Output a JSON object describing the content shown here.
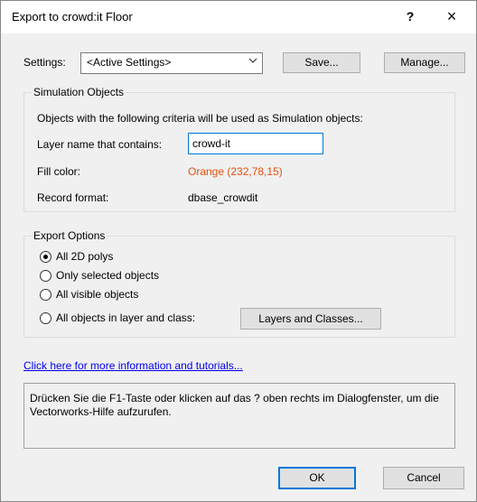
{
  "dialog": {
    "title": "Export to crowd:it Floor",
    "help_label": "?",
    "close_label": "×"
  },
  "settings": {
    "label": "Settings:",
    "selected": "<Active Settings>",
    "save_label": "Save...",
    "manage_label": "Manage..."
  },
  "simulation": {
    "group_title": "Simulation Objects",
    "description": "Objects with the following criteria will be used as Simulation objects:",
    "layer_label": "Layer name that contains:",
    "layer_value": "crowd-it",
    "fill_label": "Fill color:",
    "fill_value": "Orange (232,78,15)",
    "fill_color": "#e84e0f",
    "record_label": "Record format:",
    "record_value": "dbase_crowdit"
  },
  "export_options": {
    "group_title": "Export Options",
    "options": [
      {
        "label": "All 2D polys",
        "selected": true
      },
      {
        "label": "Only selected objects",
        "selected": false
      },
      {
        "label": "All visible objects",
        "selected": false
      },
      {
        "label": "All objects in layer and class:",
        "selected": false
      }
    ],
    "layers_button": "Layers and Classes..."
  },
  "help_link": "Click here for more information and tutorials...",
  "info_text": "Drücken Sie die F1-Taste oder klicken auf das ? oben rechts im Dialogfenster, um die Vectorworks-Hilfe aufzurufen.",
  "footer": {
    "ok_label": "OK",
    "cancel_label": "Cancel"
  }
}
